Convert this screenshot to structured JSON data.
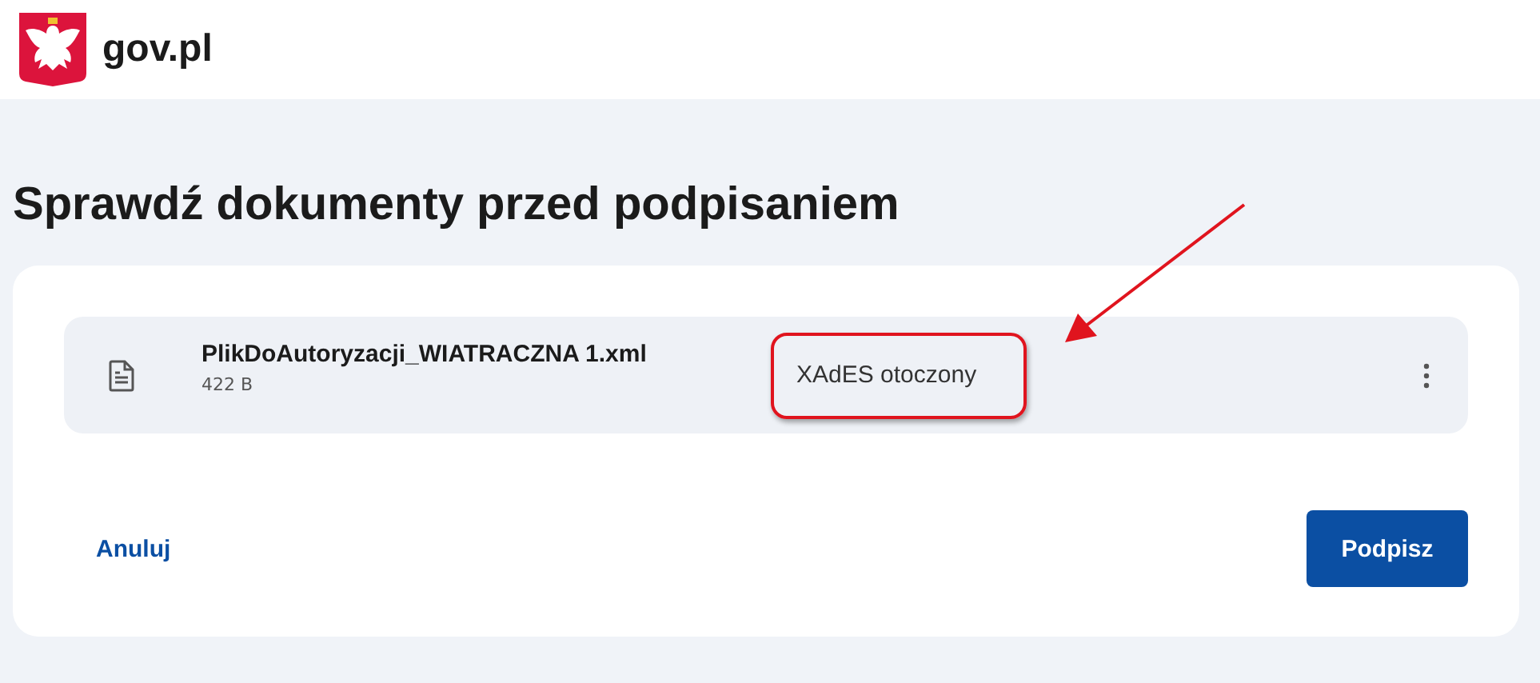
{
  "header": {
    "logo_text": "gov.pl"
  },
  "title": "Sprawdź dokumenty przed podpisaniem",
  "files": [
    {
      "name": "PlikDoAutoryzacji_WIATRACZNA 1.xml",
      "size": "422 B",
      "format": "XAdES otoczony",
      "format_highlighted": true
    }
  ],
  "actions": {
    "cancel": "Anuluj",
    "sign": "Podpisz"
  }
}
